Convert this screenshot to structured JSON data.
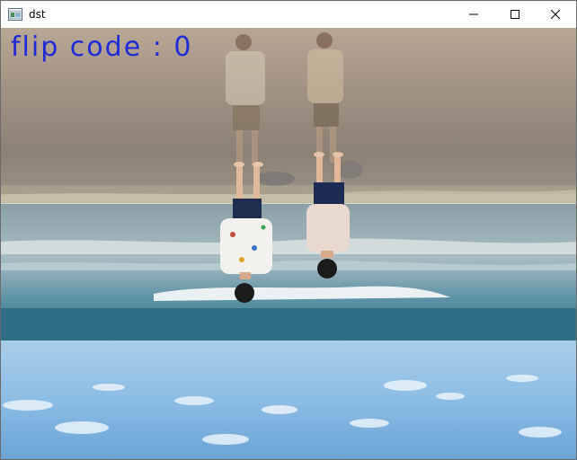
{
  "window": {
    "title": "dst",
    "controls": {
      "minimize": "minimize-icon",
      "maximize": "maximize-icon",
      "close": "close-icon"
    }
  },
  "image": {
    "overlay_text": "flip code : 0",
    "overlay_color": "#1f2bd8",
    "description_colors": {
      "sand": "#9c8f82",
      "sea": "#3f7f98",
      "sky": "#7db4de"
    }
  }
}
